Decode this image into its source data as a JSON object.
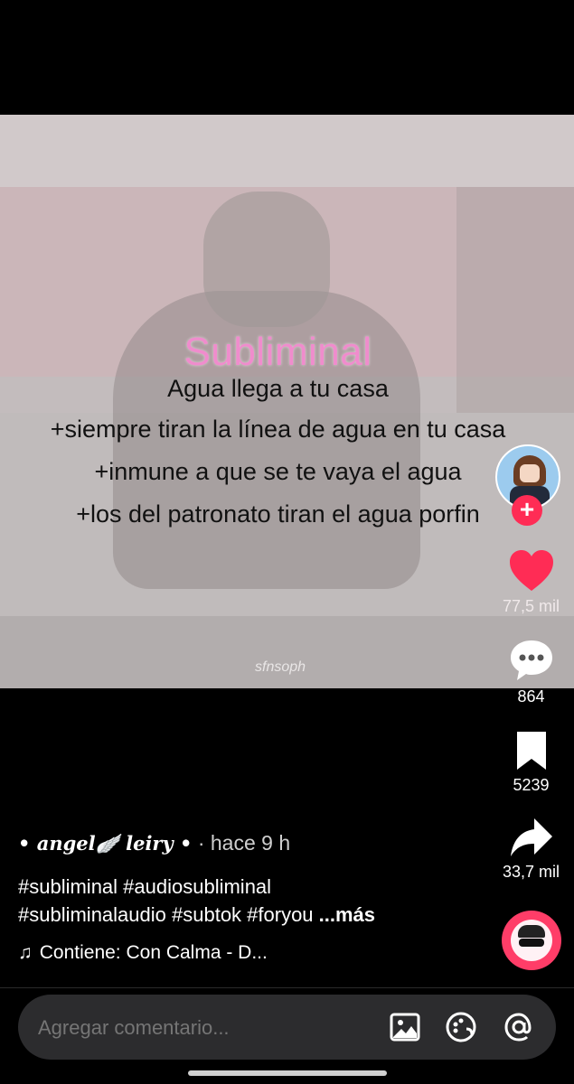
{
  "video": {
    "title": "Subliminal",
    "lines": [
      "Agua llega a tu casa",
      "+siempre tiran la línea de agua en tu casa",
      "+inmune a que se te vaya el agua",
      "+los del patronato tiran el agua porfin"
    ],
    "watermark": "sfnsoph"
  },
  "actions": {
    "follow_icon": "plus-icon",
    "likes": "77,5 mil",
    "comments": "864",
    "saves": "5239",
    "shares": "33,7 mil"
  },
  "post": {
    "author_prefix": "• angel",
    "author_wing": "🪽",
    "author_suffix": " leiry •",
    "separator": " · ",
    "time": "hace 9 h",
    "hashtags_line1": "#subliminal #audiosubliminal",
    "hashtags_line2": "#subliminalaudio #subtok #foryou ",
    "more": "...más",
    "music": "Contiene: Con Calma - D..."
  },
  "comment_bar": {
    "placeholder": "Agregar comentario..."
  },
  "colors": {
    "accent": "#ff2c55",
    "title_pink": "#f08ccd",
    "bar_bg": "#2c2c2e"
  },
  "icons": [
    "plus-icon",
    "heart-icon",
    "comment-icon",
    "bookmark-icon",
    "share-icon",
    "music-note-icon",
    "image-icon",
    "emoji-icon",
    "mention-icon"
  ]
}
